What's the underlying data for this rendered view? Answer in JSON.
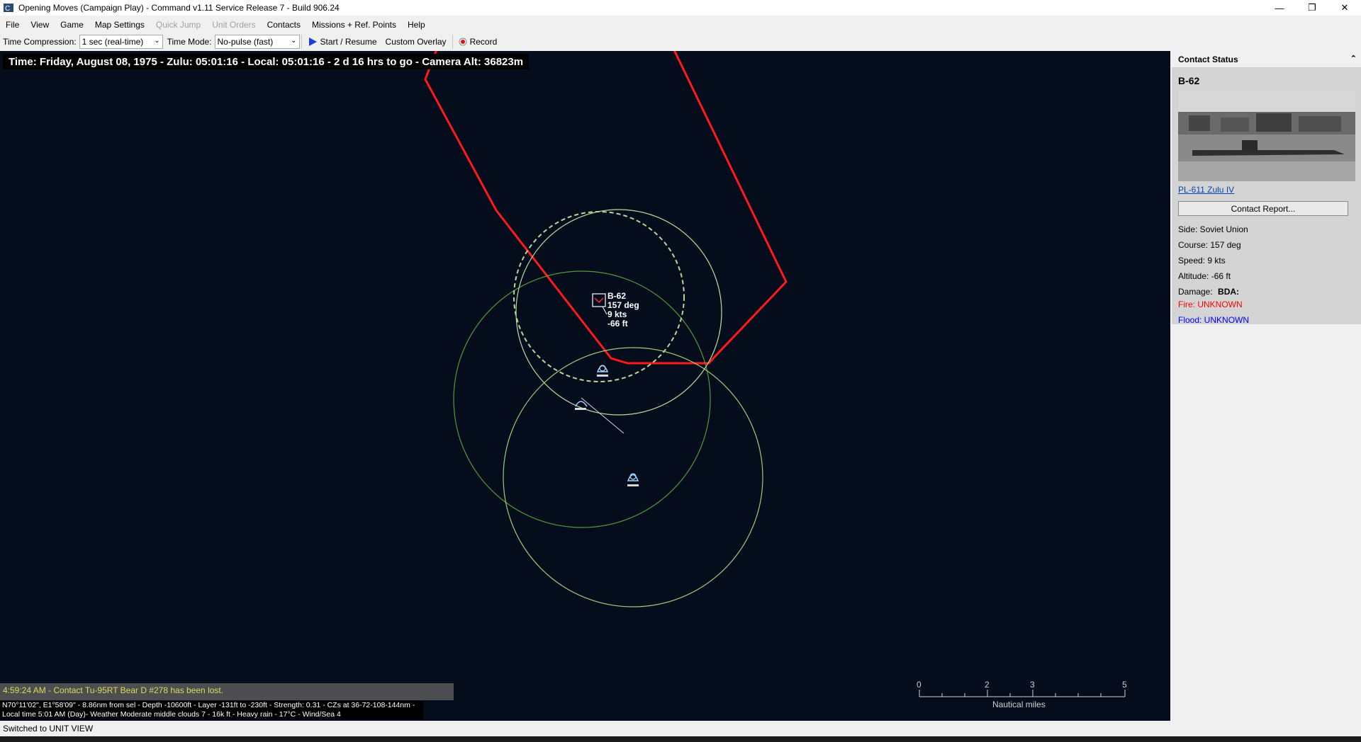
{
  "window": {
    "title": "Opening Moves (Campaign Play) - Command v1.11 Service Release 7 - Build 906.24",
    "minimize": "—",
    "restore": "❐",
    "close": "✕"
  },
  "menu": {
    "items": [
      {
        "label": "File",
        "enabled": true
      },
      {
        "label": "View",
        "enabled": true
      },
      {
        "label": "Game",
        "enabled": true
      },
      {
        "label": "Map Settings",
        "enabled": true
      },
      {
        "label": "Quick Jump",
        "enabled": false
      },
      {
        "label": "Unit Orders",
        "enabled": false
      },
      {
        "label": "Contacts",
        "enabled": true
      },
      {
        "label": "Missions + Ref. Points",
        "enabled": true
      },
      {
        "label": "Help",
        "enabled": true
      }
    ]
  },
  "toolbar": {
    "time_compression_label": "Time Compression:",
    "time_compression_value": "1 sec (real-time)",
    "time_mode_label": "Time Mode:",
    "time_mode_value": "No-pulse (fast)",
    "start_label": "Start / Resume",
    "overlay_label": "Custom Overlay",
    "record_label": "Record"
  },
  "map": {
    "time_text": "Time: Friday, August 08, 1975 - Zulu: 05:01:16 - Local: 05:01:16 - 2 d 16 hrs to go -  Camera Alt: 36823m",
    "contact": {
      "name": "B-62",
      "course": "157 deg",
      "speed": "9 kts",
      "depth": "-66 ft"
    },
    "message": "4:59:24 AM - Contact Tu-95RT Bear D #278 has been lost.",
    "coord_line1": "N70°11'02\", E1°58'09\" - 8.86nm from sel - Depth -10600ft - Layer -131ft to -230ft - Strength: 0.31 - CZs at 36-72-108-144nm -",
    "coord_line2": "Local time 5:01 AM (Day)- Weather Moderate middle clouds 7 - 16k ft - Heavy rain - 17°C - Wind/Sea 4",
    "scale": {
      "ticks": [
        "0",
        "2",
        "3",
        "5"
      ],
      "unit": "Nautical miles"
    },
    "colors": {
      "background": "#050d1d",
      "patrol_zone": "#ff1a1a",
      "sensor_ring": "#9ccc7a",
      "contact_label": "#ffffff"
    }
  },
  "status_bar": {
    "text": "Switched to UNIT VIEW"
  },
  "contact_panel": {
    "header": "Contact Status",
    "name": "B-62",
    "class_link": "PL-611 Zulu IV",
    "report_button": "Contact Report...",
    "side": "Side: Soviet Union",
    "course": "Course: 157 deg",
    "speed": "Speed: 9 kts",
    "altitude": "Altitude: -66 ft",
    "damage_label": "Damage:",
    "bda_label": "BDA:",
    "fire": "Fire: UNKNOWN",
    "flood": "Flood: UNKNOWN"
  }
}
